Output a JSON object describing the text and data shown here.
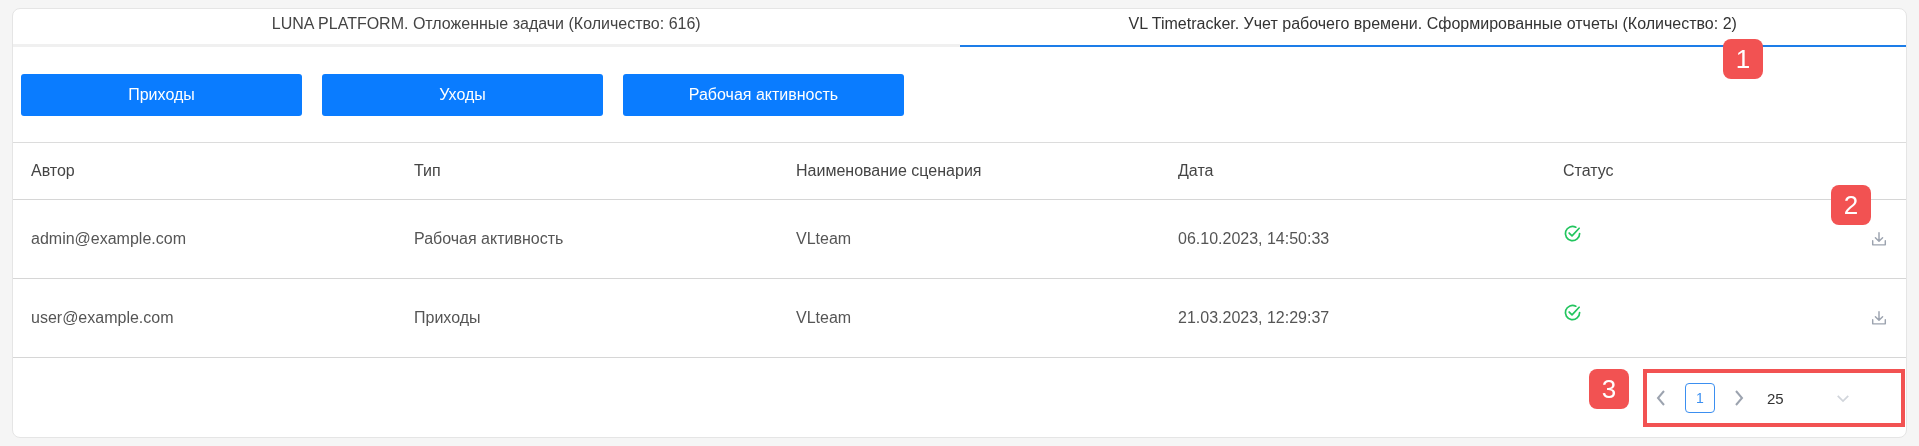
{
  "tabs": [
    {
      "label": "LUNA PLATFORM. Отложенные задачи (Количество: 616)",
      "selected": false
    },
    {
      "label": "VL Timetracker. Учет рабочего времени. Сформированные отчеты (Количество: 2)",
      "selected": true
    }
  ],
  "buttons": [
    "Приходы",
    "Уходы",
    "Рабочая активность"
  ],
  "table": {
    "columns": [
      "Автор",
      "Тип",
      "Наименование сценария",
      "Дата",
      "Статус"
    ],
    "rows": [
      {
        "author": "admin@example.com",
        "type": "Рабочая активность",
        "scenario": "VLteam",
        "date": "06.10.2023, 14:50:33",
        "success": true
      },
      {
        "author": "user@example.com",
        "type": "Приходы",
        "scenario": "VLteam",
        "date": "21.03.2023, 12:29:37",
        "success": true
      }
    ]
  },
  "pagination": {
    "pages": [
      {
        "label": "1",
        "selected": true
      }
    ],
    "page_size": "25"
  },
  "annotations": [
    "1",
    "2",
    "3"
  ]
}
